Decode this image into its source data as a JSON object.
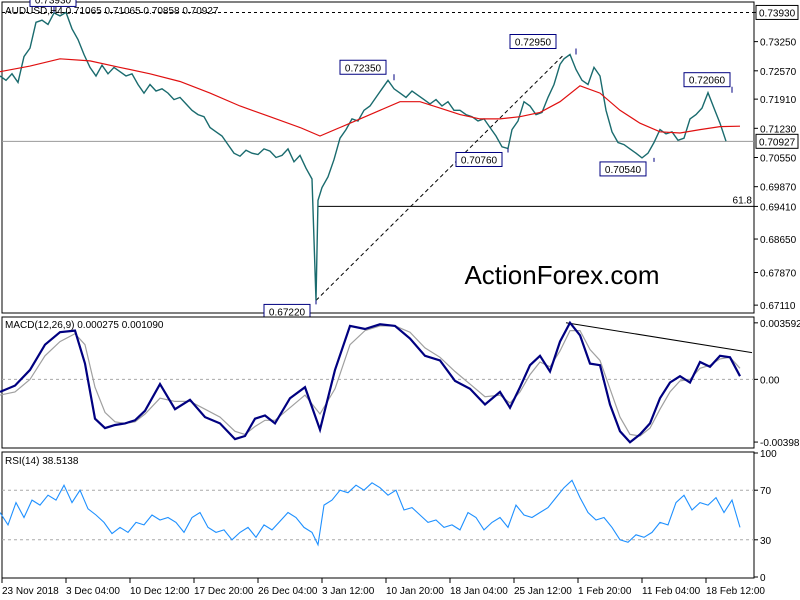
{
  "chart_data": [
    {
      "type": "candlestick",
      "title": "AUDUSD,H4  0.71065 0.71065 0.70858 0.70927",
      "ylim": [
        0.6695,
        0.7415
      ],
      "yticks": [
        "0.73930",
        "0.73250",
        "0.72570",
        "0.71910",
        "0.71230",
        "0.70550",
        "0.69870",
        "0.69410",
        "0.68650",
        "0.67870",
        "0.67110"
      ],
      "grid": false,
      "price_line": {
        "label": "0.70927",
        "value": 0.70927
      },
      "top_line": {
        "label": "0.73930",
        "value": 0.7393
      },
      "fib_line": {
        "label": "61.8",
        "value": 0.6941
      },
      "price_x": [
        0,
        6,
        12,
        18,
        24,
        30,
        36,
        42,
        48,
        54,
        60,
        66,
        72,
        78,
        84,
        90,
        96,
        102,
        108,
        114,
        120,
        126,
        132,
        138,
        144,
        150,
        156,
        162,
        168,
        174,
        180,
        186,
        192,
        198,
        204,
        210,
        216,
        222,
        228,
        234,
        240,
        246,
        252,
        258,
        264,
        270,
        276,
        282,
        288,
        294,
        300,
        306,
        312,
        316,
        318,
        322,
        328,
        334,
        340,
        346,
        352,
        358,
        364,
        370,
        376,
        382,
        388,
        394,
        400,
        406,
        412,
        418,
        424,
        430,
        436,
        442,
        448,
        454,
        460,
        466,
        472,
        478,
        484,
        490,
        496,
        502,
        508,
        512,
        518,
        524,
        530,
        536,
        542,
        548,
        554,
        560,
        564,
        570,
        576,
        582,
        588,
        594,
        600,
        606,
        612,
        618,
        624,
        630,
        636,
        642,
        648,
        654,
        660,
        666,
        672,
        678,
        684,
        690,
        696,
        702,
        708,
        714,
        720,
        726,
        732,
        738
      ],
      "price": [
        0.7245,
        0.7235,
        0.725,
        0.723,
        0.729,
        0.731,
        0.737,
        0.7375,
        0.7365,
        0.7392,
        0.7385,
        0.7393,
        0.7355,
        0.733,
        0.7295,
        0.7265,
        0.7245,
        0.727,
        0.725,
        0.7265,
        0.7255,
        0.7245,
        0.725,
        0.7225,
        0.7205,
        0.7225,
        0.721,
        0.7215,
        0.7205,
        0.719,
        0.7195,
        0.718,
        0.7165,
        0.7155,
        0.715,
        0.7125,
        0.7115,
        0.7105,
        0.7085,
        0.7065,
        0.7058,
        0.7072,
        0.7065,
        0.7062,
        0.7075,
        0.707,
        0.7055,
        0.706,
        0.7075,
        0.7045,
        0.706,
        0.703,
        0.7005,
        0.6722,
        0.6955,
        0.6985,
        0.701,
        0.705,
        0.71,
        0.712,
        0.7145,
        0.714,
        0.7165,
        0.7175,
        0.7195,
        0.7215,
        0.7235,
        0.7215,
        0.7205,
        0.7195,
        0.721,
        0.72,
        0.719,
        0.718,
        0.719,
        0.7175,
        0.7185,
        0.7165,
        0.7165,
        0.7155,
        0.715,
        0.714,
        0.7145,
        0.7125,
        0.7105,
        0.708,
        0.7076,
        0.712,
        0.714,
        0.7185,
        0.7175,
        0.7155,
        0.716,
        0.7195,
        0.7225,
        0.7272,
        0.7285,
        0.7295,
        0.726,
        0.7235,
        0.7225,
        0.7265,
        0.7245,
        0.7165,
        0.7115,
        0.709,
        0.7085,
        0.7075,
        0.7065,
        0.7054,
        0.7065,
        0.709,
        0.712,
        0.711,
        0.7115,
        0.7095,
        0.71,
        0.7145,
        0.7155,
        0.717,
        0.7206,
        0.717,
        0.7135,
        0.7093
      ],
      "ma_x": [
        0,
        30,
        60,
        90,
        120,
        150,
        180,
        210,
        240,
        270,
        300,
        320,
        340,
        360,
        380,
        400,
        420,
        440,
        460,
        480,
        500,
        520,
        540,
        560,
        580,
        600,
        620,
        640,
        660,
        680,
        700,
        720,
        740
      ],
      "ma": [
        0.7255,
        0.7268,
        0.7285,
        0.728,
        0.7265,
        0.725,
        0.7232,
        0.7205,
        0.7175,
        0.715,
        0.7125,
        0.7105,
        0.7125,
        0.7145,
        0.7165,
        0.7185,
        0.7185,
        0.717,
        0.7155,
        0.7145,
        0.7145,
        0.715,
        0.716,
        0.7185,
        0.7222,
        0.7205,
        0.7165,
        0.7135,
        0.7115,
        0.7112,
        0.712,
        0.7127,
        0.7128
      ],
      "labels": [
        {
          "text": "0.73930",
          "x": 54,
          "value": 0.7393
        },
        {
          "text": "0.72350",
          "x": 394,
          "value": 0.7235
        },
        {
          "text": "0.72950",
          "x": 576,
          "value": 0.7295
        },
        {
          "text": "0.70760",
          "x": 508,
          "value": 0.7076
        },
        {
          "text": "0.70540",
          "x": 654,
          "value": 0.7054
        },
        {
          "text": "0.72060",
          "x": 732,
          "value": 0.7206
        },
        {
          "text": "0.67220",
          "x": 316,
          "value": 0.6722
        }
      ],
      "trendline": {
        "from": {
          "x": 316,
          "value": 0.6722
        },
        "to": {
          "x": 564,
          "value": 0.7295
        }
      }
    },
    {
      "type": "line",
      "title": "MACD(12,26,9) 0.000275 0.001090",
      "ylim": [
        -0.0043,
        0.0039
      ],
      "yticks": [
        "0.003592",
        "0.00",
        "-0.003986"
      ],
      "zero_line": true,
      "x": [
        0,
        15,
        30,
        45,
        60,
        75,
        85,
        95,
        105,
        115,
        125,
        135,
        145,
        160,
        175,
        190,
        205,
        220,
        235,
        245,
        255,
        265,
        275,
        290,
        305,
        320,
        335,
        350,
        365,
        380,
        395,
        410,
        425,
        440,
        455,
        470,
        485,
        500,
        510,
        520,
        530,
        540,
        550,
        560,
        570,
        580,
        590,
        600,
        610,
        620,
        630,
        640,
        650,
        660,
        670,
        680,
        690,
        700,
        710,
        720,
        730,
        740
      ],
      "series": [
        {
          "name": "MACD",
          "values": [
            -0.0008,
            -0.0004,
            0.0006,
            0.0022,
            0.003,
            0.0031,
            0.001,
            -0.0025,
            -0.0031,
            -0.0029,
            -0.0028,
            -0.0026,
            -0.002,
            -0.0003,
            -0.0019,
            -0.0013,
            -0.0024,
            -0.0028,
            -0.0038,
            -0.0036,
            -0.0025,
            -0.0023,
            -0.0028,
            -0.0012,
            -0.0005,
            -0.0032,
            0.0006,
            0.0034,
            0.0032,
            0.0035,
            0.0034,
            0.0026,
            0.0015,
            0.0012,
            -0.0001,
            -0.0006,
            -0.0016,
            -0.0008,
            -0.0018,
            -0.0005,
            0.0009,
            0.0015,
            0.0005,
            0.0024,
            0.0036,
            0.0028,
            0.001,
            0.0009,
            -0.0016,
            -0.0033,
            -0.004,
            -0.0035,
            -0.0028,
            -0.0012,
            -0.0002,
            0.0002,
            -0.0002,
            0.0011,
            0.0008,
            0.0015,
            0.0014,
            0.0002
          ]
        },
        {
          "name": "Signal",
          "values": [
            -0.001,
            -0.0008,
            0.0,
            0.0015,
            0.0024,
            0.0029,
            0.0022,
            -0.0005,
            -0.0021,
            -0.0027,
            -0.0028,
            -0.0027,
            -0.0022,
            -0.0012,
            -0.0014,
            -0.0014,
            -0.0019,
            -0.0024,
            -0.0033,
            -0.0035,
            -0.003,
            -0.0026,
            -0.0026,
            -0.0018,
            -0.001,
            -0.0022,
            -0.0006,
            0.0022,
            0.0031,
            0.0034,
            0.0034,
            0.003,
            0.002,
            0.0014,
            0.0005,
            -0.0003,
            -0.0011,
            -0.001,
            -0.0015,
            -0.0008,
            0.0003,
            0.0011,
            0.0008,
            0.0018,
            0.0031,
            0.0031,
            0.0019,
            0.0012,
            -0.0006,
            -0.0024,
            -0.0035,
            -0.0036,
            -0.0031,
            -0.0019,
            -0.0008,
            -0.0001,
            0.0,
            0.0007,
            0.0009,
            0.0013,
            0.0014,
            0.0007
          ]
        }
      ],
      "divergence_line": {
        "from": {
          "x": 566,
          "value": 0.0036
        },
        "to": {
          "x": 752,
          "value": 0.0017
        }
      }
    },
    {
      "type": "line",
      "title": "RSI(14) 38.5138",
      "ylim": [
        0,
        100
      ],
      "yticks": [
        "100",
        "70",
        "30",
        "0"
      ],
      "levels": [
        70,
        30
      ],
      "x": [
        0,
        8,
        16,
        24,
        32,
        40,
        48,
        56,
        64,
        72,
        80,
        88,
        96,
        104,
        112,
        120,
        128,
        136,
        144,
        152,
        160,
        168,
        176,
        184,
        192,
        200,
        208,
        216,
        224,
        232,
        240,
        248,
        256,
        264,
        272,
        280,
        288,
        296,
        304,
        312,
        318,
        324,
        332,
        340,
        348,
        356,
        364,
        372,
        380,
        388,
        396,
        404,
        412,
        420,
        428,
        436,
        444,
        452,
        460,
        468,
        476,
        484,
        492,
        500,
        508,
        516,
        524,
        532,
        540,
        548,
        556,
        564,
        572,
        580,
        588,
        596,
        604,
        612,
        620,
        628,
        636,
        644,
        652,
        660,
        668,
        676,
        684,
        692,
        700,
        708,
        716,
        724,
        732,
        740
      ],
      "series": [
        {
          "name": "RSI",
          "values": [
            52,
            42,
            60,
            48,
            62,
            58,
            66,
            62,
            74,
            60,
            70,
            55,
            50,
            44,
            35,
            40,
            36,
            44,
            42,
            50,
            46,
            48,
            44,
            36,
            48,
            52,
            40,
            36,
            38,
            30,
            36,
            40,
            32,
            42,
            38,
            45,
            52,
            48,
            40,
            36,
            26,
            58,
            62,
            70,
            68,
            74,
            70,
            76,
            72,
            66,
            70,
            54,
            56,
            50,
            44,
            46,
            40,
            42,
            38,
            52,
            48,
            38,
            44,
            48,
            40,
            58,
            50,
            48,
            52,
            56,
            64,
            72,
            78,
            64,
            52,
            46,
            48,
            40,
            30,
            28,
            34,
            32,
            36,
            44,
            42,
            60,
            66,
            54,
            60,
            58,
            64,
            52,
            62,
            40
          ]
        }
      ]
    }
  ],
  "watermark": "ActionForex.com",
  "x_axis": {
    "labels": [
      "23 Nov 2018",
      "3 Dec 04:00",
      "10 Dec 12:00",
      "17 Dec 20:00",
      "26 Dec 04:00",
      "3 Jan 12:00",
      "10 Jan 20:00",
      "18 Jan 04:00",
      "25 Jan 12:00",
      "1 Feb 20:00",
      "11 Feb 04:00",
      "18 Feb 12:00"
    ]
  },
  "colors": {
    "price": "#1a6b6e",
    "ma": "#e01010",
    "macd": "#000080",
    "signal": "#a0a0a0",
    "rsi": "#1e90ff",
    "label_border": "#000080",
    "watermark": "#c4c4c4",
    "axis": "#000000",
    "level": "#888888"
  }
}
